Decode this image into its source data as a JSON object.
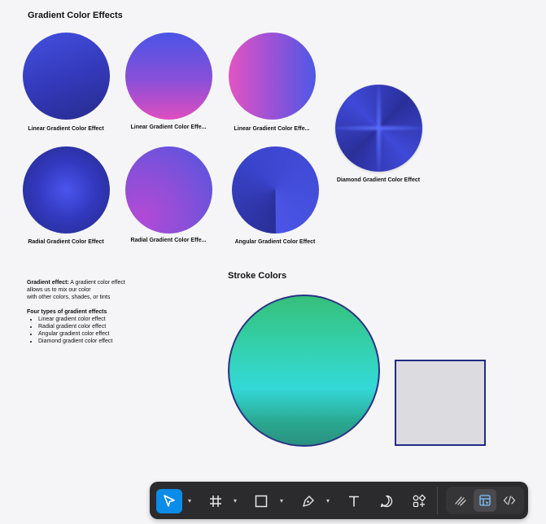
{
  "headings": {
    "gradient_effects": "Gradient Color Effects",
    "stroke_colors": "Stroke Colors"
  },
  "captions": {
    "linear1": "Linear Gradient Color Effect",
    "linear2": "Linear Gradient Color Effe...",
    "linear3": "Linear Gradient Color Effe...",
    "diamond": "Diamond Gradient Color Effect",
    "radial1": "Radial Gradient Color Effect",
    "radial2": "Radial Gradient Color Effe...",
    "angular": "Angular Gradient Color Effect"
  },
  "note": {
    "title": "Gradient effect:",
    "line1": " A gradient color effect",
    "line2": "allows us to mix our color",
    "line3": "with other colors, shades, or tints",
    "types_title": "Four types of gradient effects",
    "types": [
      "Linear gradient color effect",
      "Radial gradient color effect",
      "Angular gradient color effect",
      "Diamond gradient color effect"
    ]
  },
  "toolbar": {
    "tools": [
      "move-tool",
      "frame-tool",
      "shape-tool",
      "pen-tool",
      "text-tool",
      "comment-tool",
      "actions-tool"
    ],
    "active_tool": "move-tool",
    "modes": [
      "draw-mode",
      "design-mode",
      "dev-mode"
    ],
    "active_mode": "design-mode"
  },
  "colors": {
    "accent": "#0c8ce9",
    "toolbar_bg": "#2b2b2d",
    "canvas_bg": "#f5f5f7",
    "stroke": "#232a86"
  }
}
